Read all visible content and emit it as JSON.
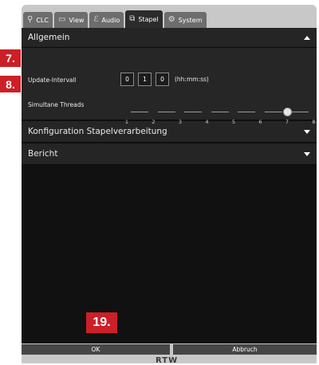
{
  "tabs": [
    {
      "label": "CLC",
      "icon": "clc-icon",
      "active": false
    },
    {
      "label": "View",
      "icon": "monitor-icon",
      "active": false
    },
    {
      "label": "Audio",
      "icon": "audio-icon",
      "active": false
    },
    {
      "label": "Stapel",
      "icon": "stack-icon",
      "active": true
    },
    {
      "label": "System",
      "icon": "gear-icon",
      "active": false
    }
  ],
  "sections": {
    "allgemein": {
      "title": "Allgemein",
      "update_label": "Update-Intervall",
      "time": {
        "hh": "0",
        "mm": "1",
        "ss": "0"
      },
      "time_format": "(hh:mm:ss)",
      "threads_label": "Simultane Threads",
      "threads_ticks": [
        "1",
        "2",
        "3",
        "4",
        "5",
        "6",
        "7",
        "8"
      ],
      "threads_value": 7
    },
    "konfiguration": {
      "title": "Konfiguration Stapelverarbeitung"
    },
    "bericht": {
      "title": "Bericht"
    }
  },
  "buttons": {
    "ok": "OK",
    "cancel": "Abbruch"
  },
  "brand": "RTW",
  "markers": {
    "m7": "7.",
    "m8": "8.",
    "m19": "19."
  },
  "colors": {
    "marker": "#cc1f27",
    "panel": "#111111",
    "section": "#252525"
  }
}
